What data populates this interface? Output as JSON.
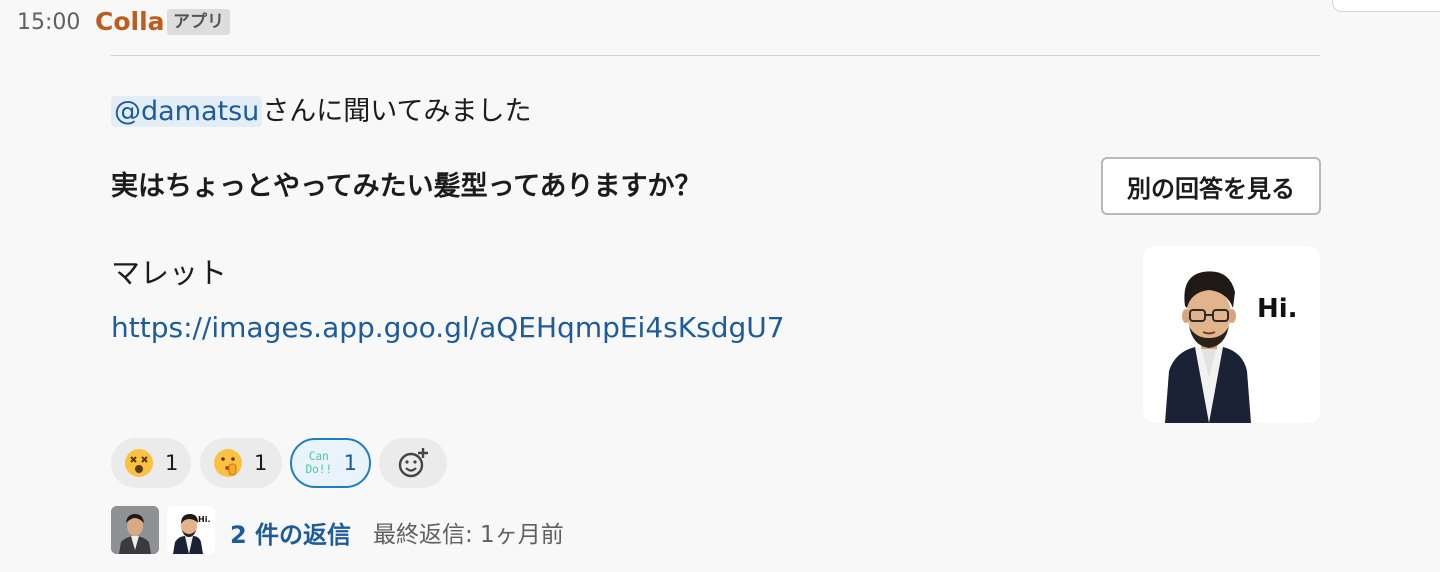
{
  "message": {
    "time": "15:00",
    "sender": "Colla",
    "badge": "アプリ",
    "mention": "@damatsu",
    "mention_suffix": "さんに聞いてみました",
    "question": "実はちょっとやってみたい髪型ってありますか？",
    "alt_button": "別の回答を見る",
    "answer": "マレット",
    "link": "https://images.app.goo.gl/aQEHqmpEi4sKsdgU7",
    "thumbnail_text": "Hi."
  },
  "reactions": [
    {
      "icon": "dizzy-face-icon",
      "count": "1"
    },
    {
      "icon": "shushing-face-icon",
      "count": "1"
    },
    {
      "icon": "can-do-sticker-icon",
      "label": "Can Do!!",
      "count": "1"
    }
  ],
  "thread": {
    "avatar_hi_text": "Hi.",
    "reply_count": "2 件の返信",
    "last_reply": "最終返信: 1ヶ月前"
  },
  "colors": {
    "sender": "#c05b1e",
    "link": "#1d5b9b",
    "selected_reaction_border": "#1d7fbe"
  }
}
